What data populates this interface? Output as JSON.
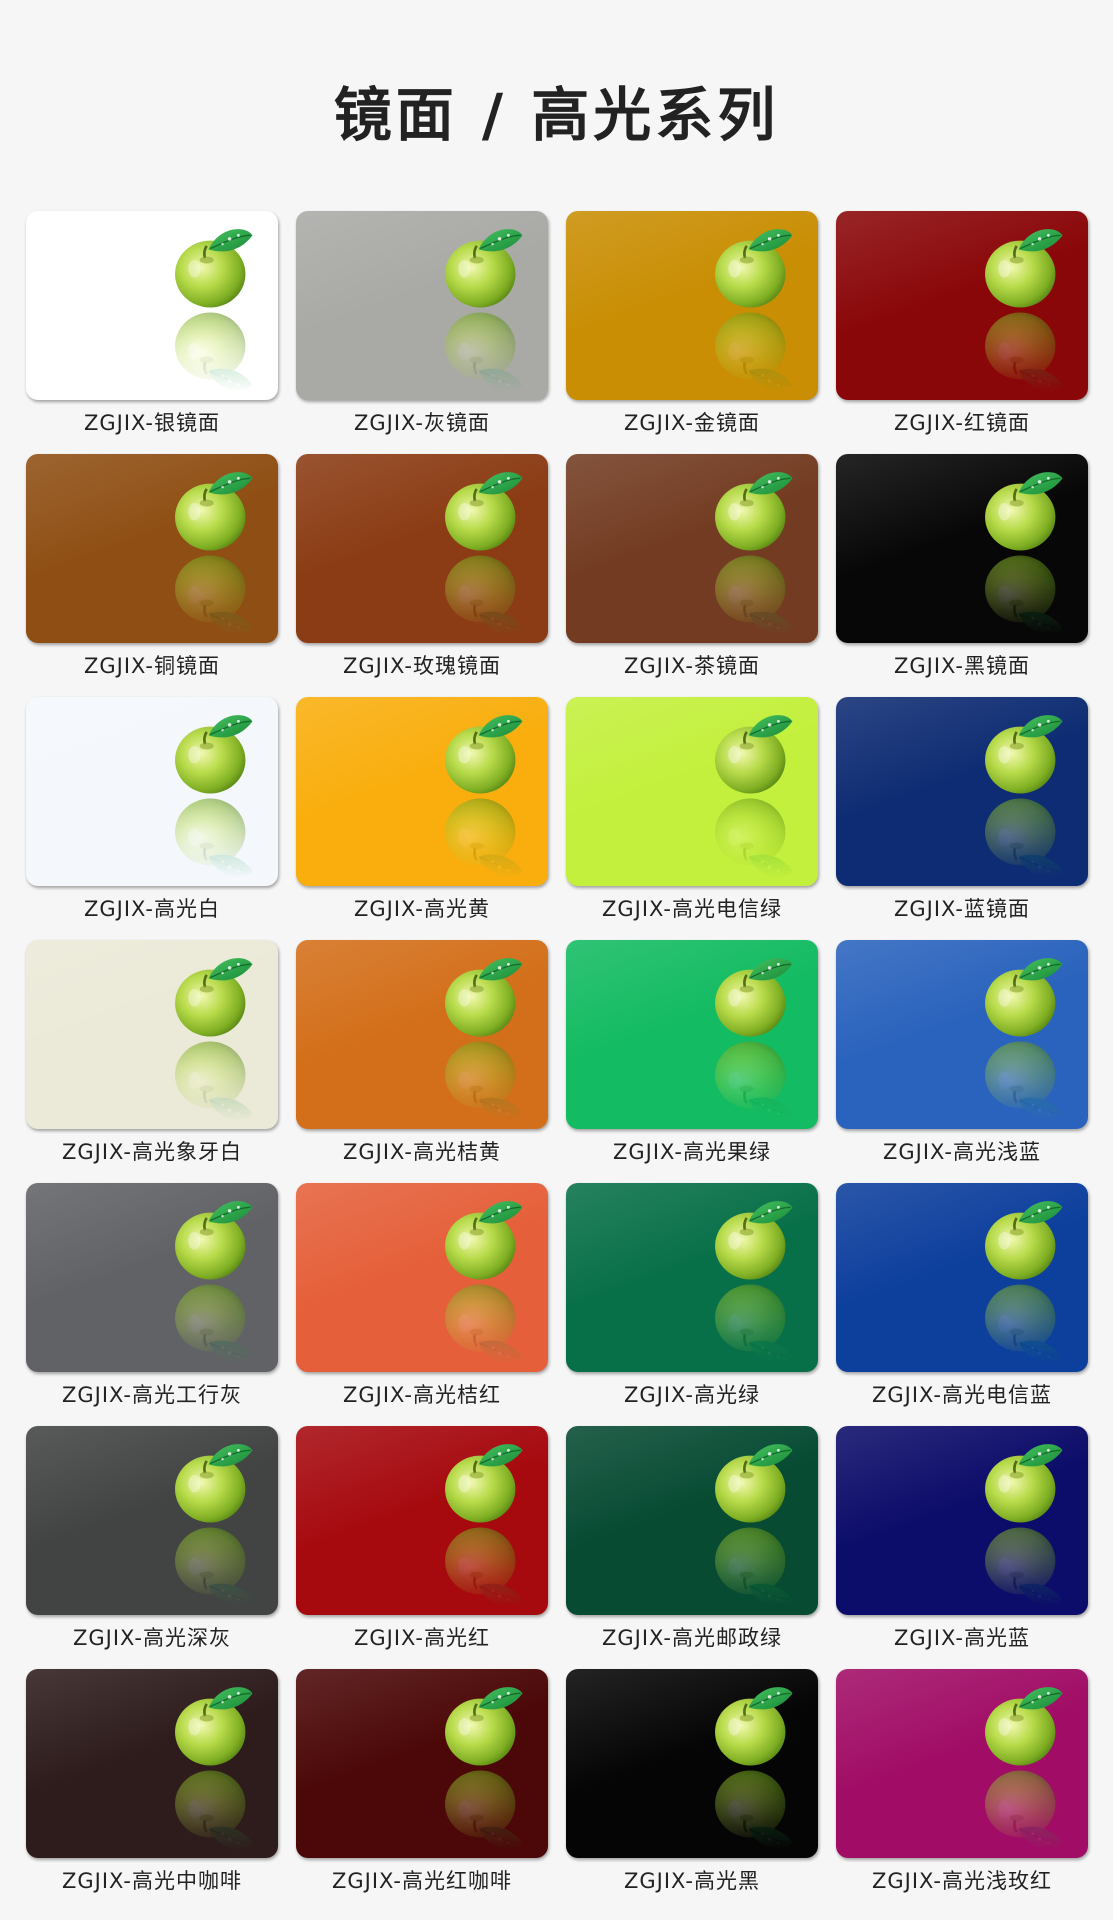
{
  "page": {
    "title": "镜面 / 高光系列"
  },
  "swatches": [
    {
      "label": "ZGJIX-银镜面",
      "color": "#ffffff"
    },
    {
      "label": "ZGJIX-灰镜面",
      "color": "#a9aaa6"
    },
    {
      "label": "ZGJIX-金镜面",
      "color": "#c98e04"
    },
    {
      "label": "ZGJIX-红镜面",
      "color": "#8a0709"
    },
    {
      "label": "ZGJIX-铜镜面",
      "color": "#8f4f14"
    },
    {
      "label": "ZGJIX-玫瑰镜面",
      "color": "#8b3c14"
    },
    {
      "label": "ZGJIX-茶镜面",
      "color": "#733c22"
    },
    {
      "label": "ZGJIX-黑镜面",
      "color": "#070707"
    },
    {
      "label": "ZGJIX-高光白",
      "color": "#f4f8fd"
    },
    {
      "label": "ZGJIX-高光黄",
      "color": "#f9ae0d"
    },
    {
      "label": "ZGJIX-高光电信绿",
      "color": "#c3f03c"
    },
    {
      "label": "ZGJIX-蓝镜面",
      "color": "#0e2c73"
    },
    {
      "label": "ZGJIX-高光象牙白",
      "color": "#ebe9d7"
    },
    {
      "label": "ZGJIX-高光桔黄",
      "color": "#d36f1a"
    },
    {
      "label": "ZGJIX-高光果绿",
      "color": "#13bb62"
    },
    {
      "label": "ZGJIX-高光浅蓝",
      "color": "#2a63bd"
    },
    {
      "label": "ZGJIX-高光工行灰",
      "color": "#606265"
    },
    {
      "label": "ZGJIX-高光桔红",
      "color": "#e5603a"
    },
    {
      "label": "ZGJIX-高光绿",
      "color": "#087049"
    },
    {
      "label": "ZGJIX-高光电信蓝",
      "color": "#0d3f9d"
    },
    {
      "label": "ZGJIX-高光深灰",
      "color": "#424343"
    },
    {
      "label": "ZGJIX-高光红",
      "color": "#a60a0f"
    },
    {
      "label": "ZGJIX-高光邮政绿",
      "color": "#074b33"
    },
    {
      "label": "ZGJIX-高光蓝",
      "color": "#0c0c6a"
    },
    {
      "label": "ZGJIX-高光中咖啡",
      "color": "#2e1c1c"
    },
    {
      "label": "ZGJIX-高光红咖啡",
      "color": "#4c0808"
    },
    {
      "label": "ZGJIX-高光黑",
      "color": "#050505"
    },
    {
      "label": "ZGJIX-高光浅玫红",
      "color": "#a10d66"
    }
  ],
  "icons": {
    "apple": "green-apple-icon"
  }
}
